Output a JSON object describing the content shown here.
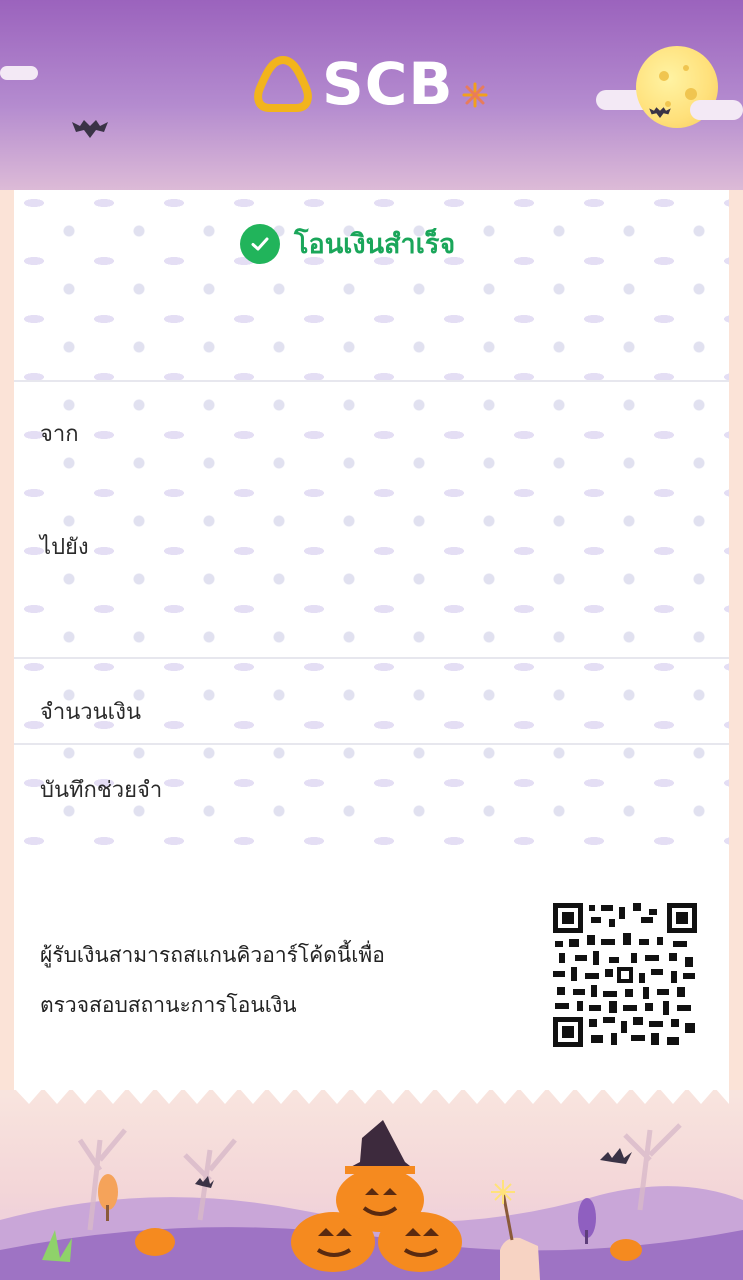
{
  "header": {
    "brand": "SCB"
  },
  "status": {
    "text": "โอนเงินสำเร็จ",
    "icon": "check-circle-icon"
  },
  "fields": {
    "from_label": "จาก",
    "to_label": "ไปยัง",
    "amount_label": "จำนวนเงิน",
    "memo_label": "บันทึกช่วยจำ"
  },
  "qr": {
    "line1": "ผู้รับเงินสามารถสแกนคิวอาร์โค้ดนี้เพื่อ",
    "line2": "ตรวจสอบสถานะการโอนเงิน",
    "icon": "qr-code-icon"
  },
  "colors": {
    "success": "#21b45b",
    "header_purple": "#9b63bd",
    "logo_gold": "#f2b41c",
    "pumpkin": "#f58a1f"
  }
}
